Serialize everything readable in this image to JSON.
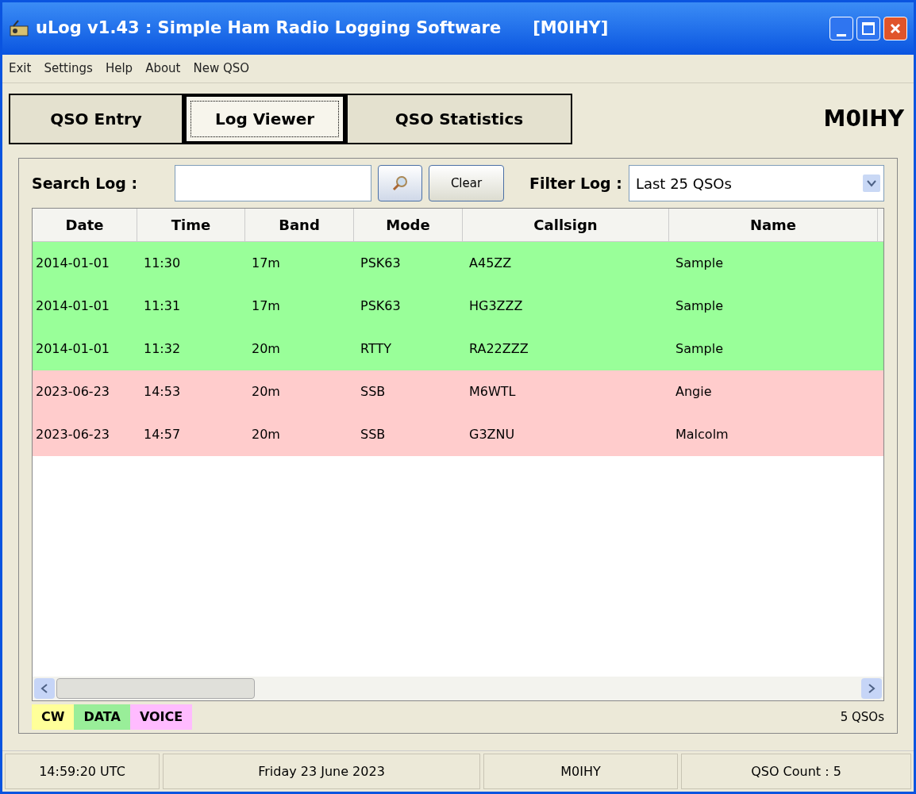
{
  "window": {
    "title": "uLog v1.43 : Simple Ham Radio Logging Software",
    "callsign_tag": "[M0IHY]"
  },
  "menu": [
    "Exit",
    "Settings",
    "Help",
    "About",
    "New QSO"
  ],
  "tabs": [
    {
      "label": "QSO Entry",
      "selected": false
    },
    {
      "label": "Log Viewer",
      "selected": true
    },
    {
      "label": "QSO Statistics",
      "selected": false
    }
  ],
  "station_callsign": "M0IHY",
  "search": {
    "label": "Search Log :",
    "clear": "Clear"
  },
  "filter": {
    "label": "Filter Log :",
    "value": "Last 25 QSOs"
  },
  "table": {
    "columns": [
      "Date",
      "Time",
      "Band",
      "Mode",
      "Callsign",
      "Name"
    ],
    "rows": [
      {
        "color": "#99ff99",
        "cells": [
          "2014-01-01",
          "11:30",
          "17m",
          "PSK63",
          "A45ZZ",
          "Sample"
        ]
      },
      {
        "color": "#99ff99",
        "cells": [
          "2014-01-01",
          "11:31",
          "17m",
          "PSK63",
          "HG3ZZZ",
          "Sample"
        ]
      },
      {
        "color": "#99ff99",
        "cells": [
          "2014-01-01",
          "11:32",
          "20m",
          "RTTY",
          "RA22ZZZ",
          "Sample"
        ]
      },
      {
        "color": "#ffcccc",
        "cells": [
          "2023-06-23",
          "14:53",
          "20m",
          "SSB",
          "M6WTL",
          "Angie"
        ]
      },
      {
        "color": "#ffcccc",
        "cells": [
          "2023-06-23",
          "14:57",
          "20m",
          "SSB",
          "G3ZNU",
          "Malcolm"
        ]
      }
    ]
  },
  "legend": [
    {
      "label": "CW",
      "color": "#ffff99"
    },
    {
      "label": "DATA",
      "color": "#99ee99"
    },
    {
      "label": "VOICE",
      "color": "#ffbbff"
    }
  ],
  "qso_total": "5 QSOs",
  "status_bar": [
    "14:59:20 UTC",
    "Friday 23 June 2023",
    "M0IHY",
    "QSO Count : 5"
  ]
}
